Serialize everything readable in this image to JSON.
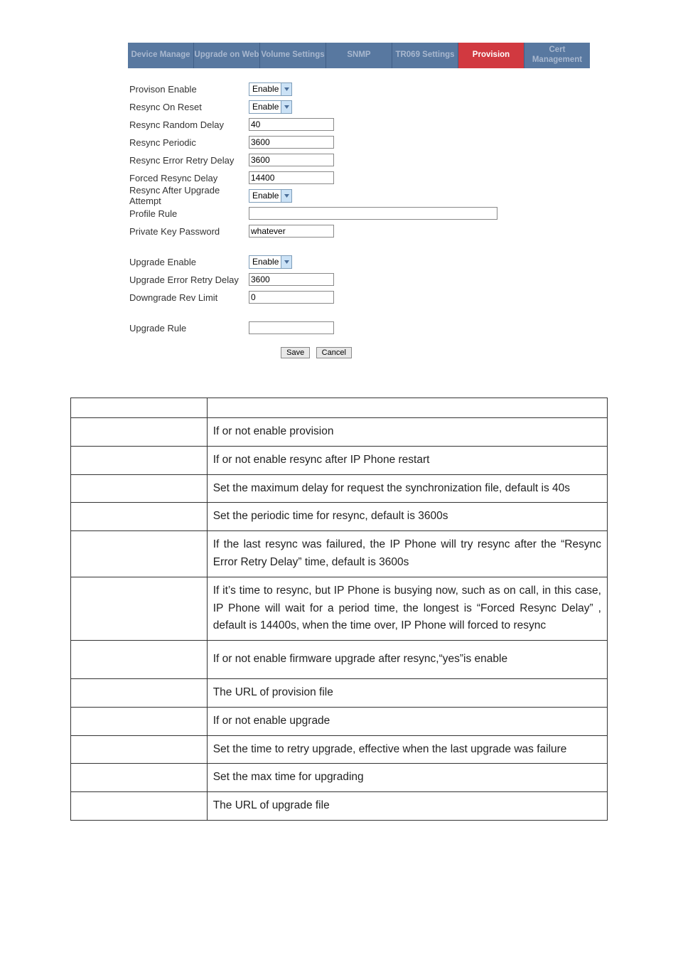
{
  "tabs": [
    {
      "label": "Device Manage"
    },
    {
      "label": "Upgrade on Web"
    },
    {
      "label": "Volume Settings"
    },
    {
      "label": "SNMP"
    },
    {
      "label": "TR069 Settings"
    },
    {
      "label": "Provision"
    },
    {
      "label": "Cert Management"
    }
  ],
  "form": {
    "provisionEnable": {
      "label": "Provison Enable",
      "value": "Enable"
    },
    "resyncOnReset": {
      "label": "Resync On Reset",
      "value": "Enable"
    },
    "resyncRandomDelay": {
      "label": "Resync Random Delay",
      "value": "40"
    },
    "resyncPeriodic": {
      "label": "Resync Periodic",
      "value": "3600"
    },
    "resyncErrorRetryDelay": {
      "label": "Resync Error Retry Delay",
      "value": "3600"
    },
    "forcedResyncDelay": {
      "label": "Forced Resync Delay",
      "value": "14400"
    },
    "resyncAfterUpgradeAttempt": {
      "label": "Resync After Upgrade Attempt",
      "value": "Enable"
    },
    "profileRule": {
      "label": "Profile Rule",
      "value": ""
    },
    "privateKeyPassword": {
      "label": "Private Key Password",
      "value": "whatever"
    },
    "upgradeEnable": {
      "label": "Upgrade Enable",
      "value": "Enable"
    },
    "upgradeErrorRetryDelay": {
      "label": "Upgrade Error Retry Delay",
      "value": "3600"
    },
    "downgradeRevLimit": {
      "label": "Downgrade Rev Limit",
      "value": "0"
    },
    "upgradeRule": {
      "label": "Upgrade Rule",
      "value": ""
    },
    "saveLabel": "Save",
    "cancelLabel": "Cancel"
  },
  "descriptions": [
    {
      "text": "If or not enable provision"
    },
    {
      "text": "If or not enable resync after IP Phone restart"
    },
    {
      "text": "Set the maximum delay for request the synchronization file, default is 40s"
    },
    {
      "text": "Set the periodic time for resync, default is 3600s"
    },
    {
      "text": "If the last resync was failured, the IP Phone will try resync after the “Resync Error Retry Delay” time, default is 3600s"
    },
    {
      "text": "If it’s time to resync, but IP Phone is busying now, such as on call, in this case, IP Phone will wait for a period time, the longest is “Forced Resync Delay” , default is 14400s, when the time over, IP Phone will forced to resync"
    },
    {
      "text": "If or not enable firmware upgrade after resync,“yes”is enable"
    },
    {
      "text": "The URL of provision file"
    },
    {
      "text": "If or not enable upgrade"
    },
    {
      "text": "Set the time to retry upgrade, effective when the last upgrade was failure"
    },
    {
      "text": "Set the max time for upgrading"
    },
    {
      "text": "The URL of upgrade file"
    }
  ]
}
